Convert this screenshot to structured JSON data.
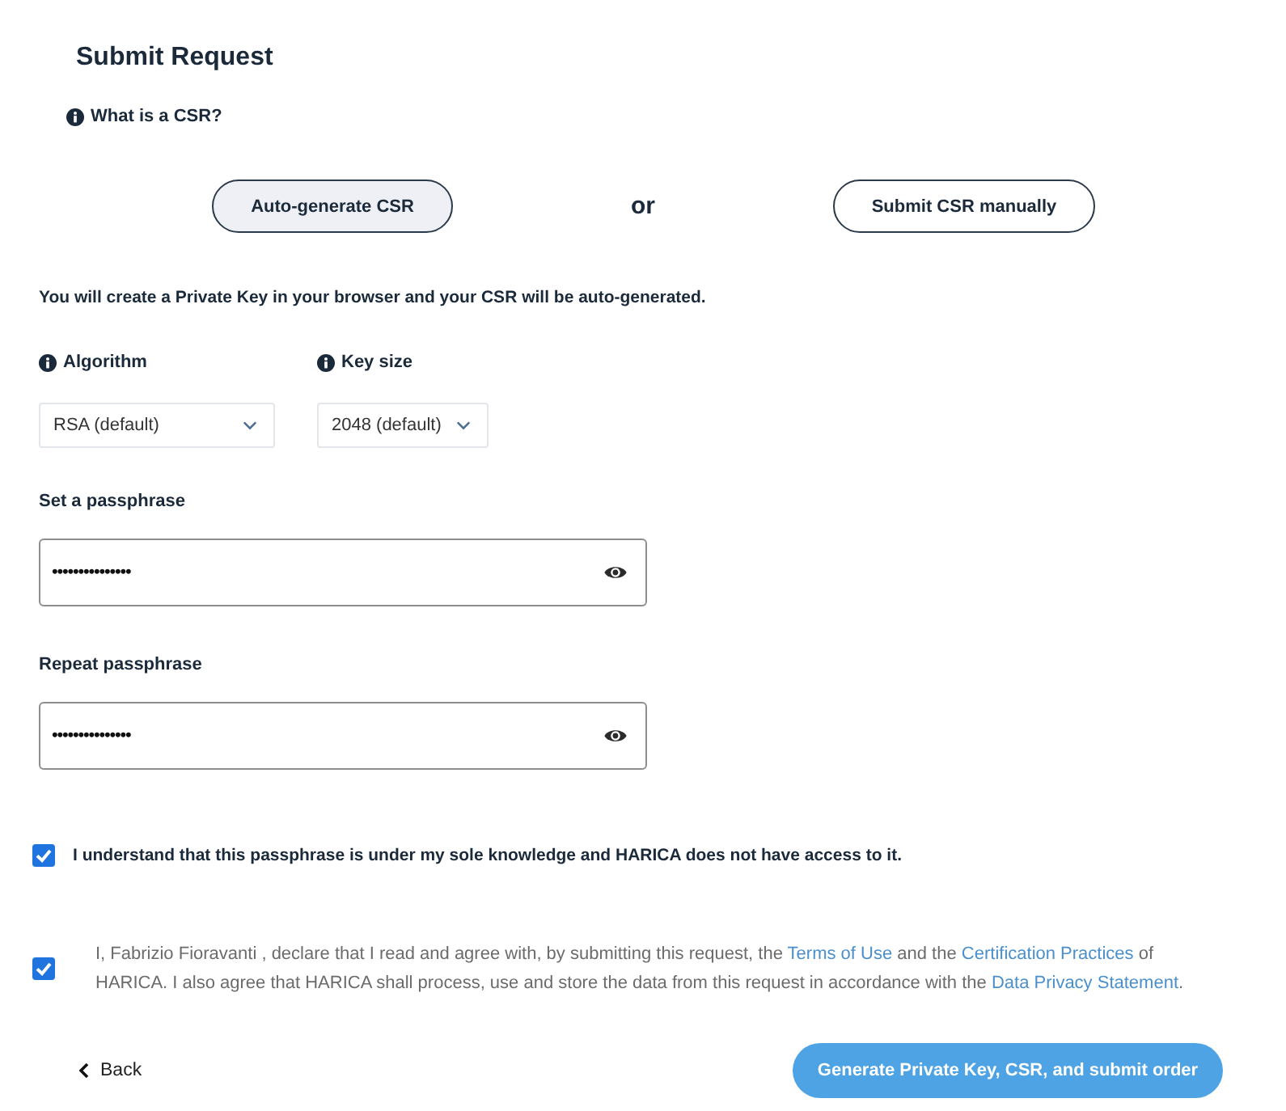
{
  "page": {
    "title": "Submit Request"
  },
  "help_link": {
    "label": "What is a CSR?"
  },
  "csr_methods": [
    {
      "label": "Auto-generate CSR",
      "selected": true
    },
    {
      "label": "Submit CSR manually",
      "selected": false
    }
  ],
  "method_separator": "or",
  "description": "You will create a Private Key in your browser and your CSR will be auto-generated.",
  "key_options": [
    {
      "label": "Algorithm",
      "value": "RSA (default)"
    },
    {
      "label": "Key size",
      "value": "2048 (default)"
    }
  ],
  "passphrase_fields": [
    {
      "label": "Set a passphrase",
      "value": "•••••••••••••••"
    },
    {
      "label": "Repeat passphrase",
      "value": "•••••••••••••••"
    }
  ],
  "agreements": [
    {
      "kind": "notice",
      "checked": true,
      "parts": [
        {
          "kind": "text",
          "text": "I understand that this passphrase is under my sole knowledge and HARICA does not have access to it."
        }
      ]
    },
    {
      "kind": "terms",
      "checked": true,
      "parts": [
        {
          "kind": "text",
          "text": "I, Fabrizio Fioravanti , declare that I read and agree with, by submitting this request, the "
        },
        {
          "kind": "link",
          "text": "Terms of Use"
        },
        {
          "kind": "text",
          "text": " and the "
        },
        {
          "kind": "link",
          "text": "Certification Practices"
        },
        {
          "kind": "text",
          "text": " of HARICA. I also agree that HARICA shall process, use and store the data from this request in accordance with the "
        },
        {
          "kind": "link",
          "text": "Data Privacy Statement"
        },
        {
          "kind": "text",
          "text": "."
        }
      ]
    }
  ],
  "actions": {
    "back": "Back",
    "submit": "Generate Private Key, CSR, and submit order"
  }
}
